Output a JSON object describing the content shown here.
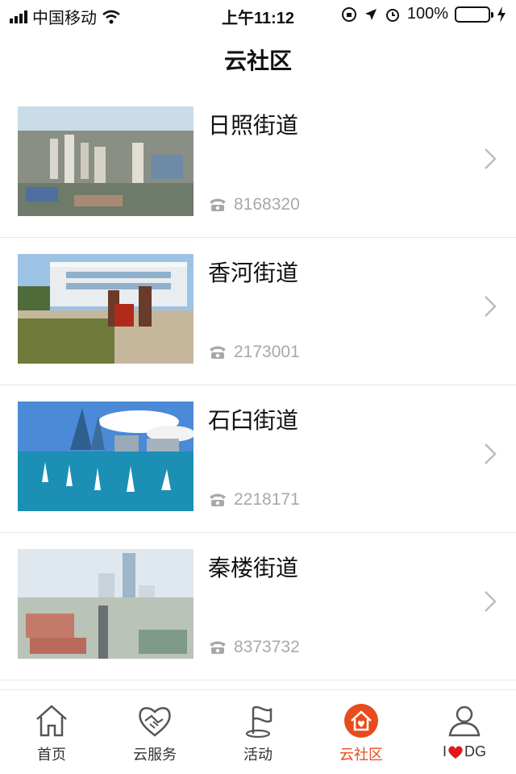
{
  "status": {
    "carrier": "中国移动",
    "time": "上午11:12",
    "battery": "100%"
  },
  "header": {
    "title": "云社区"
  },
  "list": [
    {
      "name": "日照街道",
      "phone": "8168320"
    },
    {
      "name": "香河街道",
      "phone": "2173001"
    },
    {
      "name": "石臼街道",
      "phone": "2218171"
    },
    {
      "name": "秦楼街道",
      "phone": "8373732"
    }
  ],
  "tabs": [
    {
      "label": "首页",
      "icon": "home-icon"
    },
    {
      "label": "云服务",
      "icon": "handshake-heart-icon"
    },
    {
      "label": "活动",
      "icon": "flag-icon"
    },
    {
      "label": "云社区",
      "icon": "community-home-icon",
      "active": true
    },
    {
      "label_prefix": "I",
      "label_suffix": "DG",
      "icon": "user-icon"
    }
  ],
  "colors": {
    "accent": "#e84b1d",
    "battery": "#4cd964",
    "muted": "#a8a8a8"
  }
}
